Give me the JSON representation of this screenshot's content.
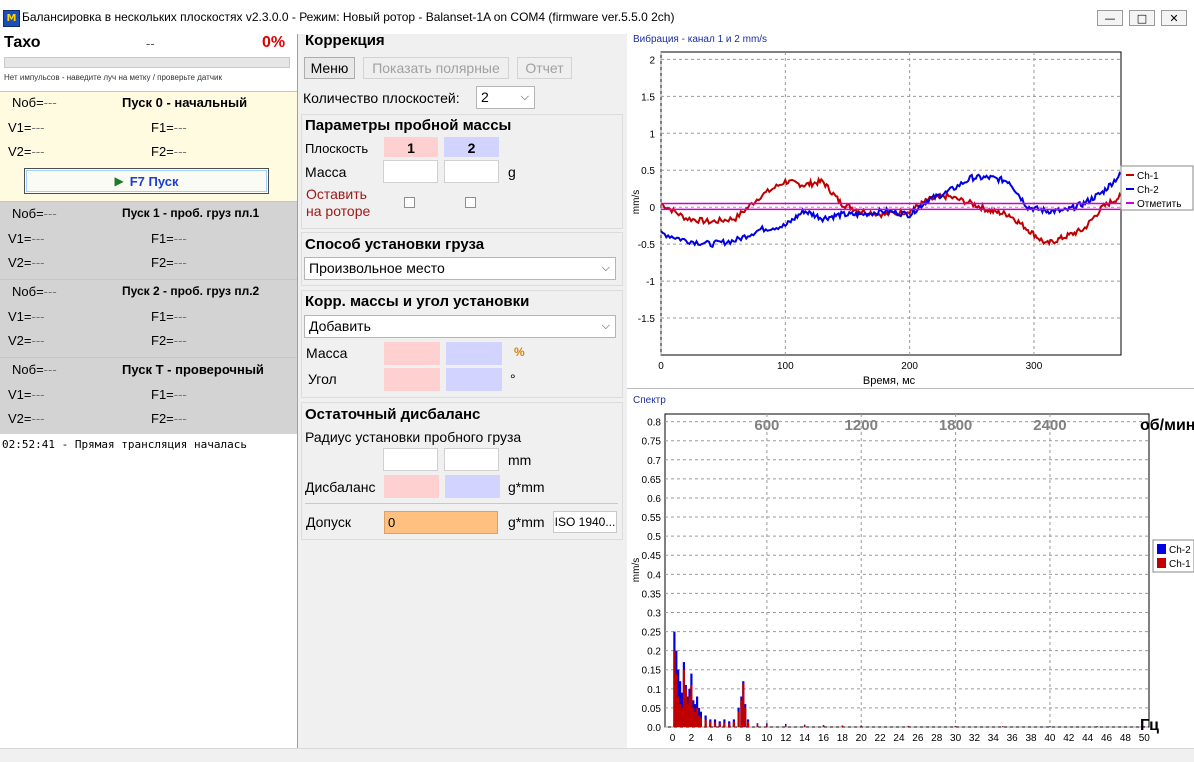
{
  "window": {
    "title": "Балансировка в нескольких плоскостях v2.3.0.0 - Режим: Новый ротор - Balanset-1A on COM4 (firmware ver.5.5.0 2ch)",
    "icon_text": "M",
    "controls": {
      "minimize": "—",
      "maximize": "□",
      "close": "✕"
    }
  },
  "tacho": {
    "label": "Тахо",
    "rpm": "--",
    "percent": "0%",
    "message": "Нет импульсов - наведите луч на метку / проверьте датчик",
    "progress": 0
  },
  "runs": [
    {
      "title": "Пуск 0 - начальный",
      "n_label": "Nоб=",
      "n_val": "---",
      "v1_label": "V1=",
      "v1_val": "---",
      "f1_label": "F1=",
      "f1_val": "---",
      "v2_label": "V2=",
      "v2_val": "---",
      "f2_label": "F2=",
      "f2_val": "---",
      "button": "F7 Пуск"
    },
    {
      "title": "Пуск 1 - проб. груз пл.1",
      "n_label": "Nоб=",
      "n_val": "---",
      "v1_label": "V1=",
      "v1_val": "---",
      "f1_label": "F1=",
      "f1_val": "---",
      "v2_label": "V2=",
      "v2_val": "---",
      "f2_label": "F2=",
      "f2_val": "---"
    },
    {
      "title": "Пуск 2 - проб. груз пл.2",
      "n_label": "Nоб=",
      "n_val": "---",
      "v1_label": "V1=",
      "v1_val": "---",
      "f1_label": "F1=",
      "f1_val": "---",
      "v2_label": "V2=",
      "v2_val": "---",
      "f2_label": "F2=",
      "f2_val": "---"
    },
    {
      "title": "Пуск Т - проверочный",
      "n_label": "Nоб=",
      "n_val": "---",
      "v1_label": "V1=",
      "v1_val": "---",
      "f1_label": "F1=",
      "f1_val": "---",
      "v2_label": "V2=",
      "v2_val": "---",
      "f2_label": "F2=",
      "f2_val": "---"
    }
  ],
  "log": "02:52:41 - Прямая трансляция началась",
  "correction": {
    "title": "Коррекция",
    "btn_menu": "Меню",
    "btn_polar": "Показать полярные",
    "btn_report": "Отчет",
    "planes_label": "Количество плоскостей:",
    "planes_value": "2"
  },
  "trial": {
    "title": "Параметры пробной массы",
    "plane_label": "Плоскость",
    "plane1": "1",
    "plane2": "2",
    "mass_label": "Масса",
    "mass_unit": "g",
    "leave_label_1": "Оставить",
    "leave_label_2": "на роторе"
  },
  "mount": {
    "title": "Способ установки груза",
    "value": "Произвольное место"
  },
  "corr": {
    "title": "Корр. массы и угол установки",
    "value": "Добавить",
    "mass_label": "Масса",
    "mass_unit": "%",
    "angle_label": "Угол",
    "angle_unit": "°"
  },
  "residual": {
    "title": "Остаточный дисбаланс",
    "radius_label": "Радиус установки пробного груза",
    "radius_unit": "mm",
    "imbalance_label": "Дисбаланс",
    "imbalance_unit": "g*mm",
    "tolerance_label": "Допуск",
    "tolerance_value": "0",
    "tolerance_unit": "g*mm",
    "iso_button": "ISO 1940..."
  },
  "colors": {
    "ch1": "#c00000",
    "ch2": "#0000e0",
    "mark": "#d000d0",
    "highlight": "#fffbe0",
    "grey": "#d3d3d3"
  },
  "chart_data": [
    {
      "type": "line",
      "title": "Вибрация - канал 1 и 2 mm/s",
      "xlabel": "Время, мс",
      "ylabel": "mm/s",
      "xlim": [
        0,
        370
      ],
      "ylim": [
        -2,
        2.1
      ],
      "xticks": [
        0,
        100,
        200,
        300
      ],
      "yticks": [
        2,
        1.5,
        1,
        0.5,
        0,
        -0.5,
        -1,
        -1.5
      ],
      "grid": true,
      "legend": "right",
      "x": [
        0,
        20,
        40,
        60,
        80,
        100,
        115,
        130,
        145,
        160,
        180,
        200,
        215,
        230,
        250,
        265,
        280,
        295,
        310,
        325,
        340,
        355,
        370
      ],
      "series": [
        {
          "name": "Ch-1",
          "values": [
            0.05,
            -0.15,
            -0.2,
            -0.15,
            0.15,
            0.35,
            0.3,
            0.35,
            0.05,
            -0.05,
            -0.1,
            -0.05,
            0.1,
            0.15,
            0.05,
            -0.05,
            -0.1,
            -0.3,
            -0.5,
            -0.4,
            -0.3,
            0.0,
            0.15
          ]
        },
        {
          "name": "Ch-2",
          "values": [
            -0.35,
            -0.45,
            -0.5,
            -0.45,
            -0.3,
            -0.25,
            -0.05,
            -0.15,
            -0.1,
            -0.1,
            -0.05,
            -0.1,
            0.1,
            0.2,
            0.4,
            0.4,
            0.35,
            0.0,
            -0.05,
            -0.05,
            0.05,
            0.2,
            0.45
          ]
        },
        {
          "name": "Отметить",
          "values": [
            -0.03,
            -0.03,
            -0.03,
            -0.03,
            -0.03,
            -0.03,
            -0.03,
            -0.03,
            -0.03,
            -0.03,
            -0.03,
            -0.03,
            -0.03,
            -0.03,
            -0.03,
            -0.03,
            -0.03,
            -0.03,
            -0.03,
            -0.03,
            -0.03,
            -0.03,
            -0.03
          ]
        }
      ],
      "mark_line": 0.05
    },
    {
      "type": "bar",
      "title": "Спектр",
      "xlabel": "Гц",
      "ylabel": "mm/s",
      "xlim": [
        -0.8,
        50.5
      ],
      "ylim": [
        0,
        0.82
      ],
      "xticks": [
        0,
        2,
        4,
        6,
        8,
        10,
        12,
        14,
        16,
        18,
        20,
        22,
        24,
        26,
        28,
        30,
        32,
        34,
        36,
        38,
        40,
        42,
        44,
        46,
        48,
        50
      ],
      "yticks": [
        0.8,
        0.75,
        0.7,
        0.65,
        0.6,
        0.55,
        0.5,
        0.45,
        0.4,
        0.35,
        0.3,
        0.25,
        0.2,
        0.15,
        0.1,
        0.05,
        0.0
      ],
      "top_labels": [
        "600",
        "1200",
        "1800",
        "2400",
        "об/мин"
      ],
      "top_label_hz": [
        10,
        20,
        30,
        40
      ],
      "grid": true,
      "legend": "right",
      "x": [
        0.2,
        0.4,
        0.6,
        0.8,
        1.0,
        1.2,
        1.4,
        1.6,
        1.8,
        2.0,
        2.2,
        2.4,
        2.6,
        2.8,
        3.0,
        3.5,
        4.0,
        4.5,
        5.0,
        5.5,
        6.0,
        6.5,
        7.0,
        7.3,
        7.5,
        7.7,
        8.0,
        9,
        10,
        12,
        14,
        16,
        18,
        20,
        25,
        30,
        35,
        40,
        45,
        50
      ],
      "series": [
        {
          "name": "Ch-2",
          "values": [
            0.25,
            0.2,
            0.15,
            0.12,
            0.09,
            0.17,
            0.11,
            0.08,
            0.1,
            0.14,
            0.07,
            0.06,
            0.08,
            0.05,
            0.04,
            0.03,
            0.02,
            0.02,
            0.015,
            0.02,
            0.015,
            0.02,
            0.05,
            0.08,
            0.12,
            0.06,
            0.02,
            0.01,
            0.01,
            0.008,
            0.006,
            0.005,
            0.004,
            0.004,
            0.003,
            0.003,
            0.002,
            0.002,
            0.002,
            0.002
          ]
        },
        {
          "name": "Ch-1",
          "values": [
            0.2,
            0.14,
            0.08,
            0.06,
            0.05,
            0.15,
            0.1,
            0.06,
            0.08,
            0.11,
            0.05,
            0.04,
            0.05,
            0.03,
            0.025,
            0.02,
            0.015,
            0.012,
            0.01,
            0.012,
            0.01,
            0.015,
            0.04,
            0.07,
            0.115,
            0.05,
            0.015,
            0.008,
            0.006,
            0.005,
            0.004,
            0.003,
            0.003,
            0.002,
            0.002,
            0.002,
            0.002,
            0.001,
            0.001,
            0.001
          ]
        }
      ]
    }
  ]
}
